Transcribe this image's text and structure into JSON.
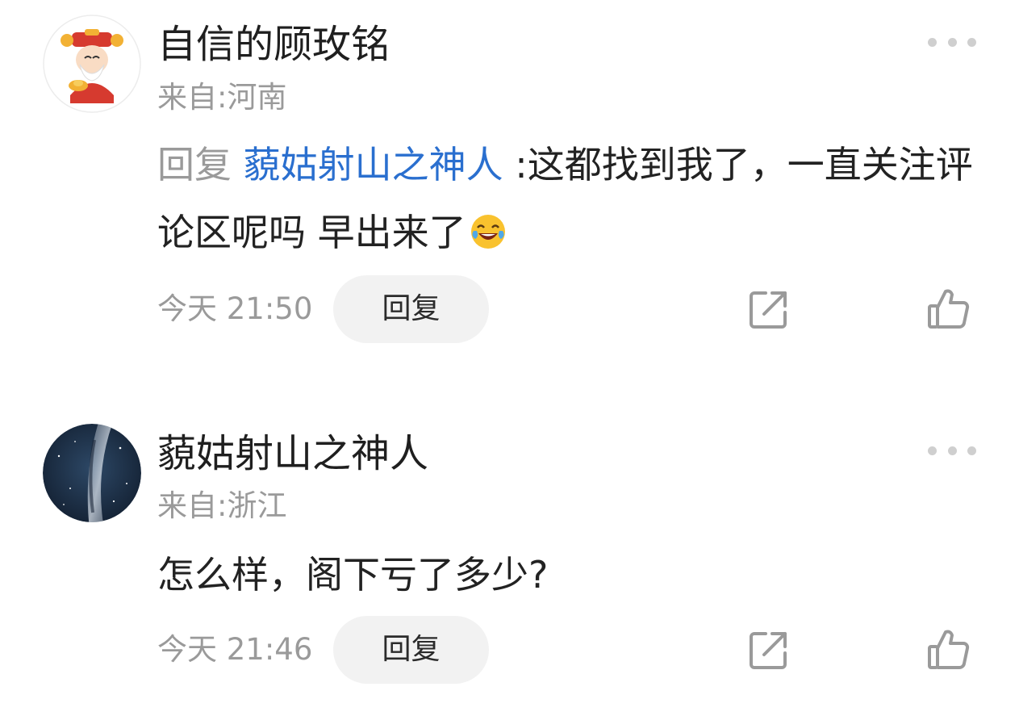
{
  "comments": [
    {
      "username": "自信的顾玫铭",
      "location": "来自:河南",
      "reply_prefix": "回复",
      "reply_target": "藐姑射山之神人",
      "reply_separator": ":",
      "text": "这都找到我了，一直关注评论区呢吗 早出来了",
      "emoji": "laughing-tears-emoji",
      "timestamp": "今天 21:50",
      "reply_button_label": "回复",
      "avatar": "god-of-wealth-cartoon-avatar"
    },
    {
      "username": "藐姑射山之神人",
      "location": "来自:浙江",
      "text": "怎么样，阁下亏了多少?",
      "timestamp": "今天 21:46",
      "reply_button_label": "回复",
      "avatar": "milky-way-night-sky-avatar"
    }
  ],
  "colors": {
    "link": "#2a6fcf",
    "secondary_text": "#9a9a9a",
    "button_bg": "#f2f2f2",
    "icon_gray": "#9a9a9a"
  },
  "icons": [
    "more-icon",
    "share-icon",
    "like-icon"
  ]
}
